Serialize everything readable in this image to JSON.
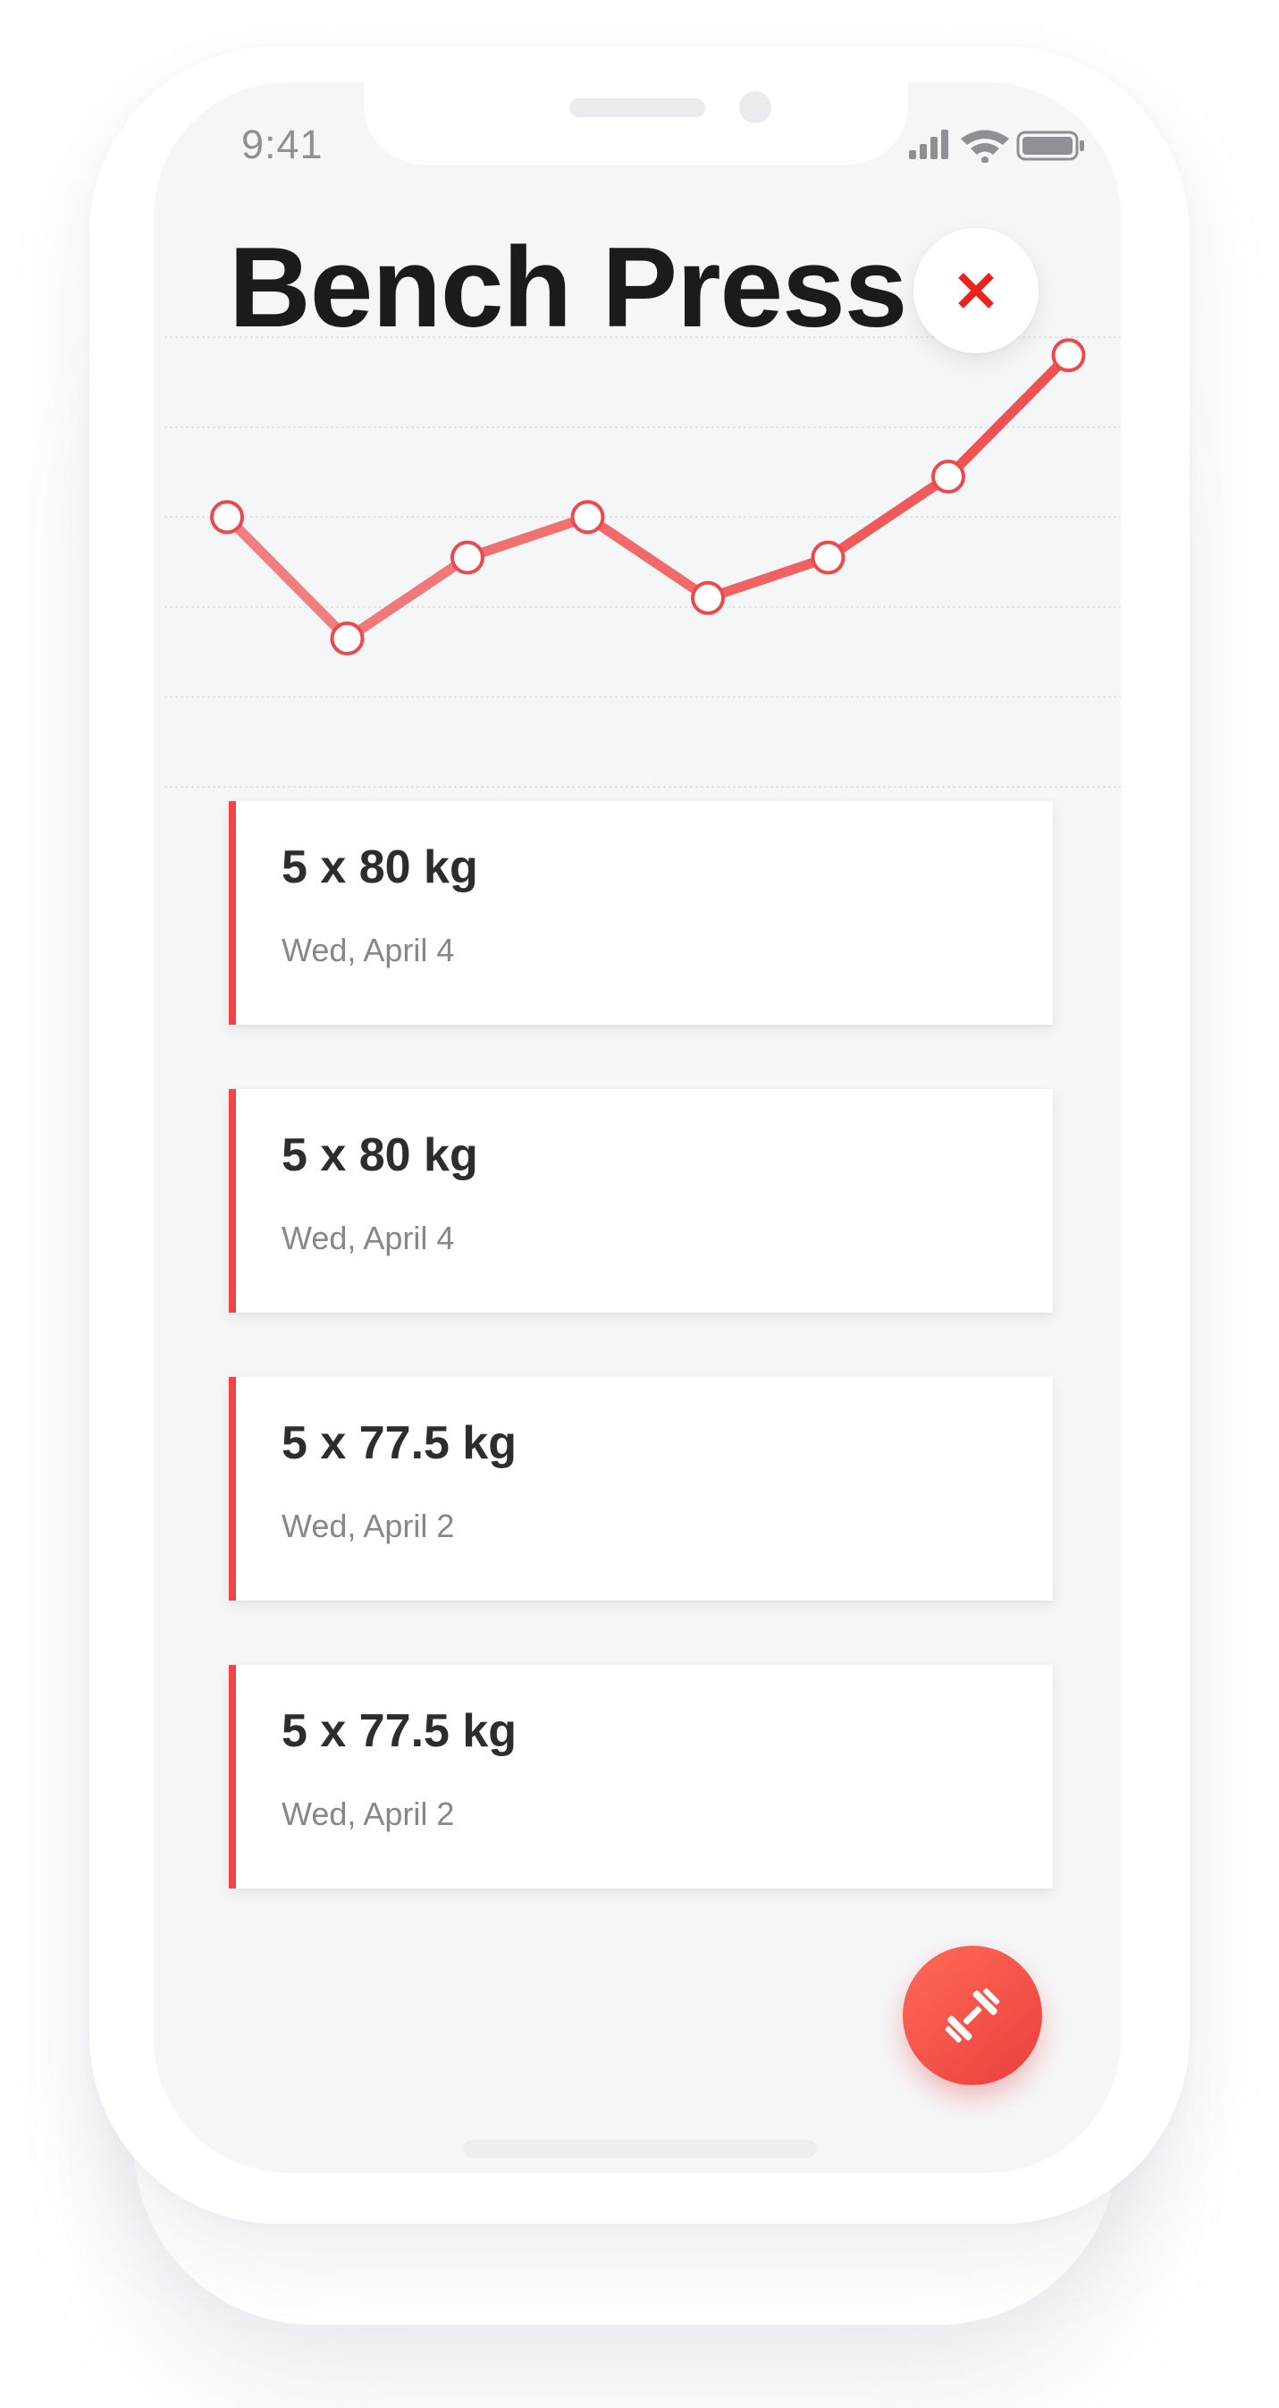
{
  "status_bar": {
    "time": "9:41",
    "icons": [
      "signal-icon",
      "wifi-icon",
      "battery-icon"
    ]
  },
  "header": {
    "title": "Bench Press",
    "close_icon": "close-icon"
  },
  "chart_data": {
    "type": "line",
    "values": [
      60,
      33,
      51,
      60,
      42,
      51,
      69,
      96
    ],
    "ylim": [
      0,
      140
    ],
    "grid": true,
    "color": "#f05151"
  },
  "entries": [
    {
      "weight": "5 x 80 kg",
      "date": "Wed, April 4"
    },
    {
      "weight": "5 x 80 kg",
      "date": "Wed, April 4"
    },
    {
      "weight": "5 x 77.5 kg",
      "date": "Wed, April 2"
    },
    {
      "weight": "5 x 77.5 kg",
      "date": "Wed, April 2"
    }
  ],
  "fab": {
    "icon": "dumbbell-icon"
  },
  "colors": {
    "accent": "#ee4646",
    "background": "#f5f6f8",
    "card": "#ffffff"
  }
}
